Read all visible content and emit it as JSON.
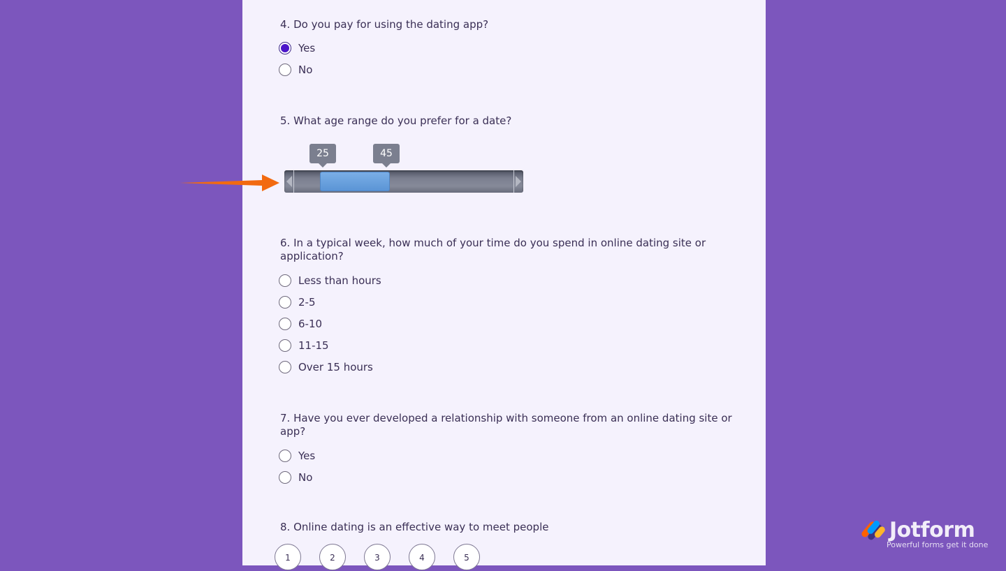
{
  "q4": {
    "label": "4. Do you pay for using the dating app?",
    "options": [
      {
        "label": "Yes",
        "checked": true
      },
      {
        "label": "No",
        "checked": false
      }
    ]
  },
  "q5": {
    "label": "5. What age range do you prefer for a date?",
    "slider": {
      "low": "25",
      "high": "45"
    }
  },
  "q6": {
    "label": "6. In a typical week, how much of your time do you spend in online dating site or application?",
    "options": [
      {
        "label": "Less than hours",
        "checked": false
      },
      {
        "label": "2-5",
        "checked": false
      },
      {
        "label": "6-10",
        "checked": false
      },
      {
        "label": "11-15",
        "checked": false
      },
      {
        "label": "Over 15 hours",
        "checked": false
      }
    ]
  },
  "q7": {
    "label": "7. Have you ever developed a relationship with someone from an online dating site or app?",
    "options": [
      {
        "label": "Yes",
        "checked": false
      },
      {
        "label": "No",
        "checked": false
      }
    ]
  },
  "q8": {
    "label": "8. Online dating is an effective way to meet people",
    "ratings": [
      "1",
      "2",
      "3",
      "4",
      "5"
    ]
  },
  "brand": {
    "name": "Jotform",
    "tagline": "Powerful forms get it done"
  },
  "colors": {
    "background": "#7c56bd",
    "panel": "#f5f2fd",
    "radio_checked": "#4b15c9",
    "slider_range": "#6aa3e0",
    "pointer_arrow": "#f26a10"
  }
}
